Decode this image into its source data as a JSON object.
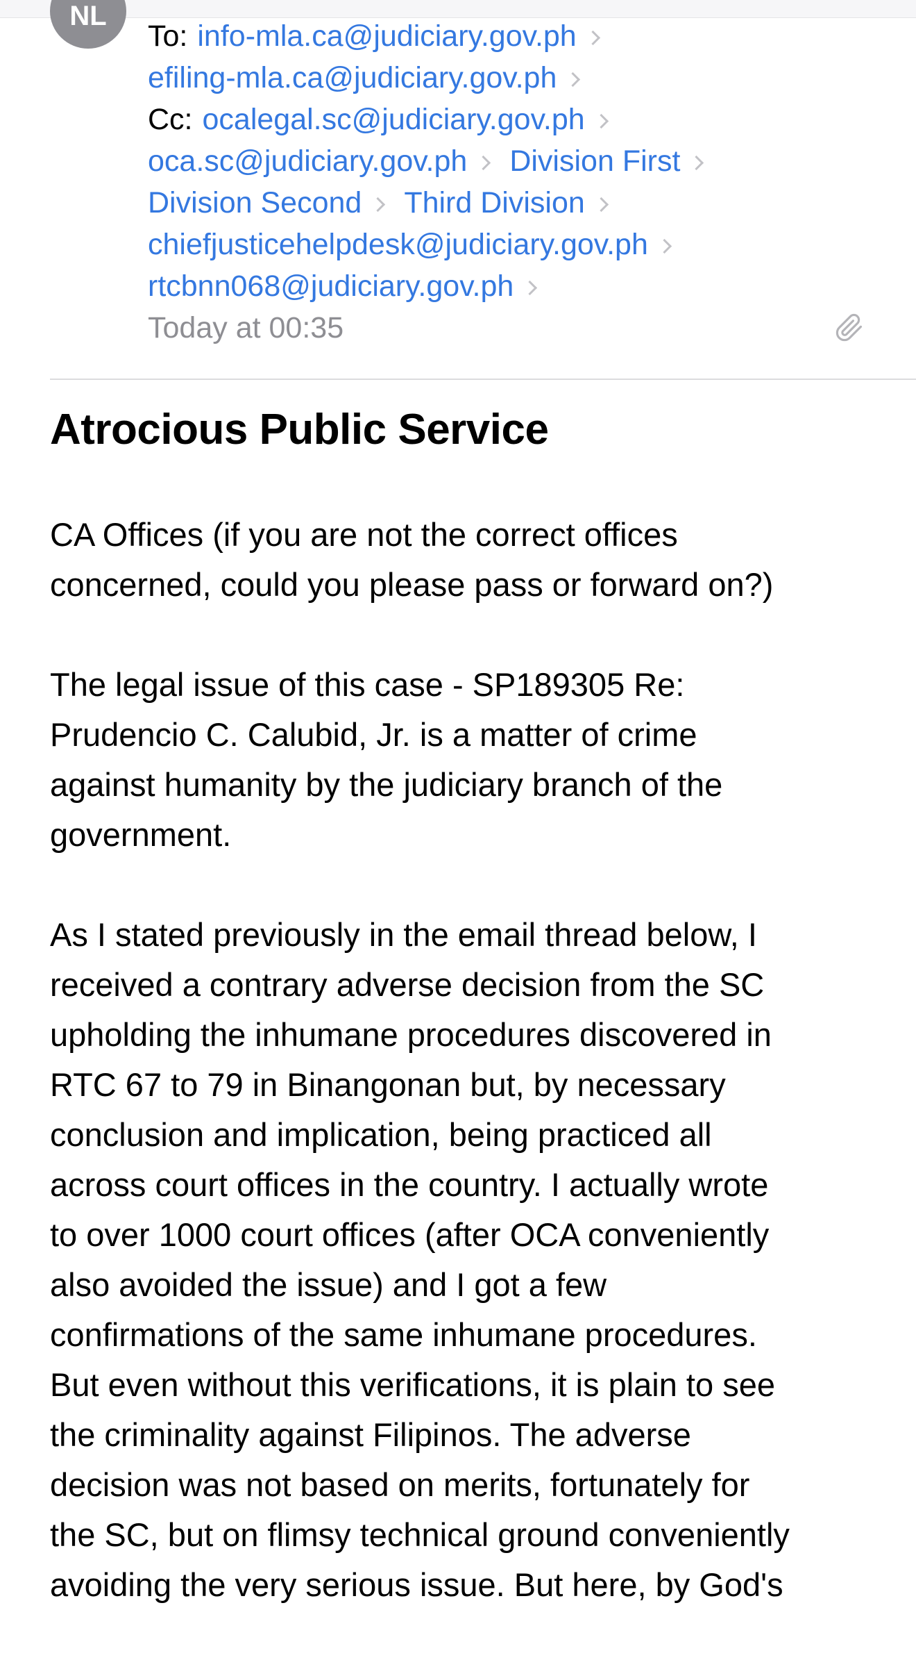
{
  "sender": {
    "avatar_initials": "NL"
  },
  "recipients": {
    "to_label": "To:",
    "cc_label": "Cc:",
    "to": [
      "info-mla.ca@judiciary.gov.ph",
      "efiling-mla.ca@judiciary.gov.ph"
    ],
    "cc": [
      "ocalegal.sc@judiciary.gov.ph",
      "oca.sc@judiciary.gov.ph",
      "Division First",
      "Division Second",
      "Third Division",
      "chiefjusticehelpdesk@judiciary.gov.ph",
      "rtcbnn068@judiciary.gov.ph"
    ]
  },
  "date": "Today at 00:35",
  "icons": {
    "attachment": "paperclip-icon",
    "recipient_chevron": "chevron-right-icon"
  },
  "colors": {
    "link": "#3478e0",
    "secondary_text": "#8e8e93",
    "avatar": "#8e8e93"
  },
  "subject": "Atrocious Public Service",
  "body": {
    "paragraphs": [
      {
        "lines": [
          "CA Offices (if you are not the correct offices",
          "concerned, could you please pass or forward on?)"
        ]
      },
      {
        "lines": [
          "The legal issue of this case - SP189305 Re:",
          "Prudencio C. Calubid, Jr.  is a matter of crime",
          "against humanity by the judiciary branch of the",
          "government."
        ]
      },
      {
        "lines": [
          "As I stated previously in the email thread below, I",
          "received a contrary adverse decision from the SC",
          "upholding the inhumane procedures discovered in",
          "RTC 67 to 79 in Binangonan but, by necessary",
          "conclusion and implication, being practiced all",
          "across court offices in the country.  I actually wrote",
          "to over 1000 court offices (after OCA conveniently",
          "also avoided the issue)  and I got a few",
          "confirmations of the same inhumane procedures.",
          "But even without this verifications, it is plain to see",
          "the criminality against Filipinos. The adverse",
          "decision was not based on merits, fortunately for",
          "the SC, but on flimsy technical ground conveniently",
          "avoiding the very serious issue. But here, by God's"
        ]
      }
    ]
  }
}
